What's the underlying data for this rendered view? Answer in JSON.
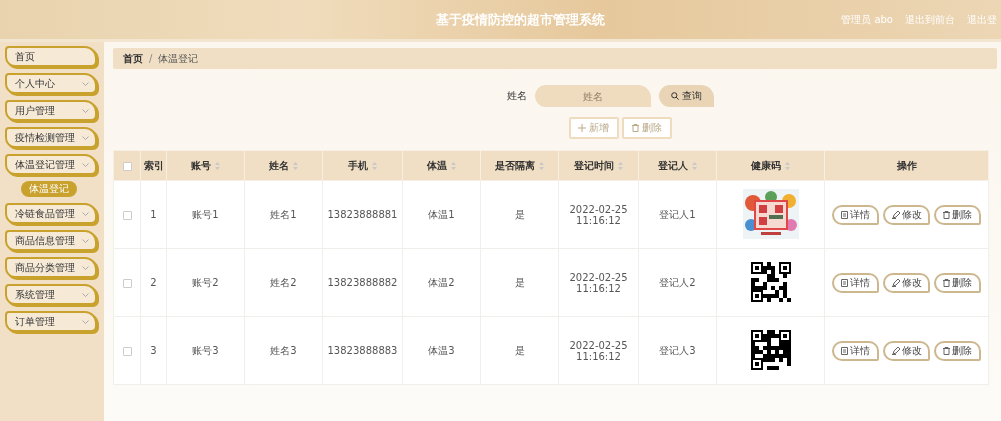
{
  "header": {
    "title": "基于疫情防控的超市管理系统",
    "links": [
      "管理员 abo",
      "退出到前台",
      "退出登"
    ]
  },
  "sidebar": {
    "items": [
      {
        "label": "首页",
        "expandable": false
      },
      {
        "label": "个人中心",
        "expandable": true
      },
      {
        "label": "用户管理",
        "expandable": true
      },
      {
        "label": "疫情检测管理",
        "expandable": true
      },
      {
        "label": "体温登记管理",
        "expandable": true,
        "children": [
          {
            "label": "体温登记",
            "selected": true
          }
        ]
      },
      {
        "label": "冷链食品管理",
        "expandable": true
      },
      {
        "label": "商品信息管理",
        "expandable": true
      },
      {
        "label": "商品分类管理",
        "expandable": true
      },
      {
        "label": "系统管理",
        "expandable": true
      },
      {
        "label": "订单管理",
        "expandable": true
      }
    ]
  },
  "breadcrumb": {
    "items": [
      "首页",
      "体温登记"
    ],
    "separator": "/"
  },
  "search": {
    "label": "姓名",
    "placeholder": "姓名",
    "button": "查询"
  },
  "actions": [
    {
      "label": "新增",
      "kind": "add",
      "disabled": true
    },
    {
      "label": "删除",
      "kind": "delete",
      "disabled": true
    }
  ],
  "table": {
    "select_all": {
      "checked": false
    },
    "columns": [
      {
        "label": "索引",
        "sortable": false
      },
      {
        "label": "账号",
        "sortable": true
      },
      {
        "label": "姓名",
        "sortable": true
      },
      {
        "label": "手机",
        "sortable": true
      },
      {
        "label": "体温",
        "sortable": true
      },
      {
        "label": "是否隔离",
        "sortable": true
      },
      {
        "label": "登记时间",
        "sortable": true
      },
      {
        "label": "登记人",
        "sortable": true
      },
      {
        "label": "健康码",
        "sortable": true
      },
      {
        "label": "操作",
        "sortable": false
      }
    ],
    "rows": [
      {
        "checked": false,
        "cells": [
          "1",
          "账号1",
          "姓名1",
          "13823888881",
          "体温1",
          "是",
          "2022-02-25 11:16:12",
          "登记人1"
        ],
        "actions": [
          {
            "label": "详情",
            "kind": "detail"
          },
          {
            "label": "修改",
            "kind": "edit"
          },
          {
            "label": "删除",
            "kind": "delete"
          }
        ]
      },
      {
        "checked": false,
        "cells": [
          "2",
          "账号2",
          "姓名2",
          "13823888882",
          "体温2",
          "是",
          "2022-02-25 11:16:12",
          "登记人2"
        ],
        "code": {
          "kind": "qr"
        },
        "actions": [
          {
            "label": "详情",
            "kind": "detail"
          },
          {
            "label": "修改",
            "kind": "edit"
          },
          {
            "label": "删除",
            "kind": "delete"
          }
        ]
      },
      {
        "checked": false,
        "cells": [
          "3",
          "账号3",
          "姓名3",
          "13823888883",
          "体温3",
          "是",
          "2022-02-25 11:16:12",
          "登记人3"
        ],
        "code": {
          "kind": "qr"
        },
        "actions": [
          {
            "label": "详情",
            "kind": "detail"
          },
          {
            "label": "修改",
            "kind": "edit"
          },
          {
            "label": "删除",
            "kind": "delete"
          }
        ]
      }
    ]
  }
}
